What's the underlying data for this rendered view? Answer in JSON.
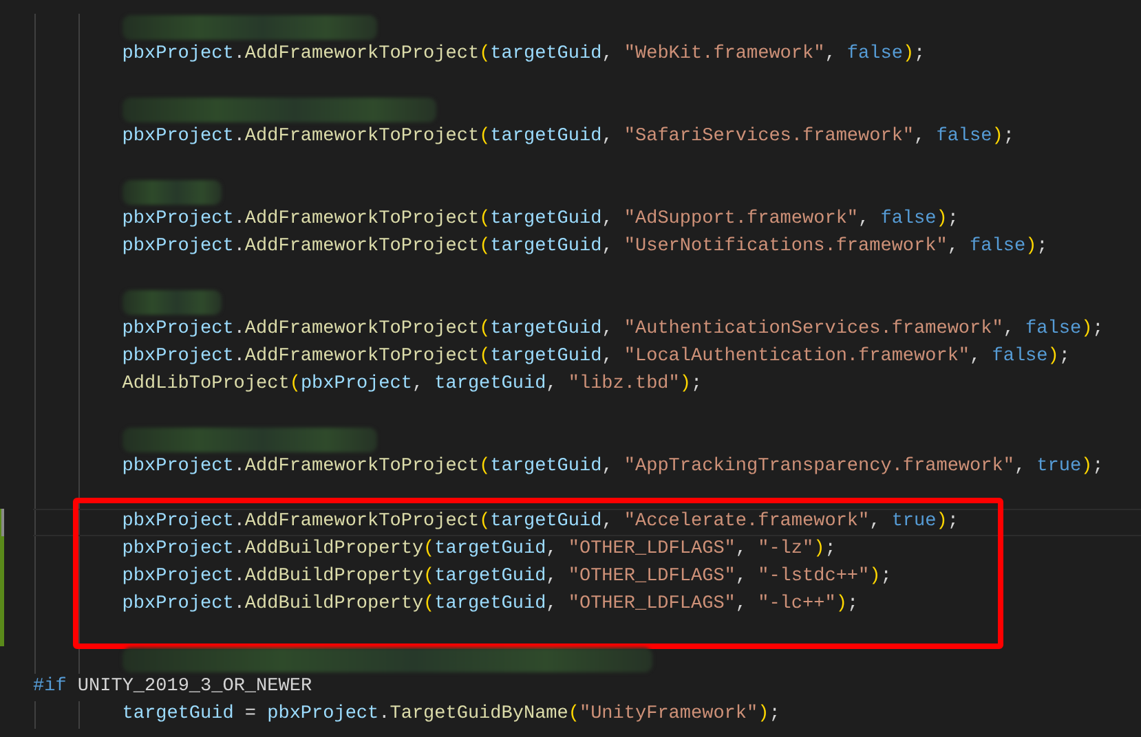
{
  "editor": {
    "lines": [
      {
        "kind": "blurred_medium"
      },
      {
        "kind": "code",
        "tokens": [
          {
            "kind": "var",
            "text": "pbxProject"
          },
          {
            "kind": "plain",
            "text": "."
          },
          {
            "kind": "method",
            "text": "AddFrameworkToProject"
          },
          {
            "kind": "paren",
            "text": "("
          },
          {
            "kind": "var",
            "text": "targetGuid"
          },
          {
            "kind": "plain",
            "text": ", "
          },
          {
            "kind": "string",
            "text": "\"WebKit.framework\""
          },
          {
            "kind": "plain",
            "text": ", "
          },
          {
            "kind": "keyword",
            "text": "false"
          },
          {
            "kind": "paren",
            "text": ")"
          },
          {
            "kind": "plain",
            "text": ";"
          }
        ]
      },
      {
        "kind": "blank"
      },
      {
        "kind": "blurred_long"
      },
      {
        "kind": "code",
        "tokens": [
          {
            "kind": "var",
            "text": "pbxProject"
          },
          {
            "kind": "plain",
            "text": "."
          },
          {
            "kind": "method",
            "text": "AddFrameworkToProject"
          },
          {
            "kind": "paren",
            "text": "("
          },
          {
            "kind": "var",
            "text": "targetGuid"
          },
          {
            "kind": "plain",
            "text": ", "
          },
          {
            "kind": "string",
            "text": "\"SafariServices.framework\""
          },
          {
            "kind": "plain",
            "text": ", "
          },
          {
            "kind": "keyword",
            "text": "false"
          },
          {
            "kind": "paren",
            "text": ")"
          },
          {
            "kind": "plain",
            "text": ";"
          }
        ]
      },
      {
        "kind": "blank"
      },
      {
        "kind": "blurred_short"
      },
      {
        "kind": "code",
        "tokens": [
          {
            "kind": "var",
            "text": "pbxProject"
          },
          {
            "kind": "plain",
            "text": "."
          },
          {
            "kind": "method",
            "text": "AddFrameworkToProject"
          },
          {
            "kind": "paren",
            "text": "("
          },
          {
            "kind": "var",
            "text": "targetGuid"
          },
          {
            "kind": "plain",
            "text": ", "
          },
          {
            "kind": "string",
            "text": "\"AdSupport.framework\""
          },
          {
            "kind": "plain",
            "text": ", "
          },
          {
            "kind": "keyword",
            "text": "false"
          },
          {
            "kind": "paren",
            "text": ")"
          },
          {
            "kind": "plain",
            "text": ";"
          }
        ]
      },
      {
        "kind": "code",
        "tokens": [
          {
            "kind": "var",
            "text": "pbxProject"
          },
          {
            "kind": "plain",
            "text": "."
          },
          {
            "kind": "method",
            "text": "AddFrameworkToProject"
          },
          {
            "kind": "paren",
            "text": "("
          },
          {
            "kind": "var",
            "text": "targetGuid"
          },
          {
            "kind": "plain",
            "text": ", "
          },
          {
            "kind": "string",
            "text": "\"UserNotifications.framework\""
          },
          {
            "kind": "plain",
            "text": ", "
          },
          {
            "kind": "keyword",
            "text": "false"
          },
          {
            "kind": "paren",
            "text": ")"
          },
          {
            "kind": "plain",
            "text": ";"
          }
        ]
      },
      {
        "kind": "blank"
      },
      {
        "kind": "blurred_short"
      },
      {
        "kind": "code",
        "tokens": [
          {
            "kind": "var",
            "text": "pbxProject"
          },
          {
            "kind": "plain",
            "text": "."
          },
          {
            "kind": "method",
            "text": "AddFrameworkToProject"
          },
          {
            "kind": "paren",
            "text": "("
          },
          {
            "kind": "var",
            "text": "targetGuid"
          },
          {
            "kind": "plain",
            "text": ", "
          },
          {
            "kind": "string",
            "text": "\"AuthenticationServices.framework\""
          },
          {
            "kind": "plain",
            "text": ", "
          },
          {
            "kind": "keyword",
            "text": "false"
          },
          {
            "kind": "paren",
            "text": ")"
          },
          {
            "kind": "plain",
            "text": ";"
          }
        ]
      },
      {
        "kind": "code",
        "tokens": [
          {
            "kind": "var",
            "text": "pbxProject"
          },
          {
            "kind": "plain",
            "text": "."
          },
          {
            "kind": "method",
            "text": "AddFrameworkToProject"
          },
          {
            "kind": "paren",
            "text": "("
          },
          {
            "kind": "var",
            "text": "targetGuid"
          },
          {
            "kind": "plain",
            "text": ", "
          },
          {
            "kind": "string",
            "text": "\"LocalAuthentication.framework\""
          },
          {
            "kind": "plain",
            "text": ", "
          },
          {
            "kind": "keyword",
            "text": "false"
          },
          {
            "kind": "paren",
            "text": ")"
          },
          {
            "kind": "plain",
            "text": ";"
          }
        ]
      },
      {
        "kind": "code",
        "tokens": [
          {
            "kind": "method",
            "text": "AddLibToProject"
          },
          {
            "kind": "paren",
            "text": "("
          },
          {
            "kind": "var",
            "text": "pbxProject"
          },
          {
            "kind": "plain",
            "text": ", "
          },
          {
            "kind": "var",
            "text": "targetGuid"
          },
          {
            "kind": "plain",
            "text": ", "
          },
          {
            "kind": "string",
            "text": "\"libz.tbd\""
          },
          {
            "kind": "paren",
            "text": ")"
          },
          {
            "kind": "plain",
            "text": ";"
          }
        ]
      },
      {
        "kind": "blank"
      },
      {
        "kind": "blurred_medium"
      },
      {
        "kind": "code",
        "tokens": [
          {
            "kind": "var",
            "text": "pbxProject"
          },
          {
            "kind": "plain",
            "text": "."
          },
          {
            "kind": "method",
            "text": "AddFrameworkToProject"
          },
          {
            "kind": "paren",
            "text": "("
          },
          {
            "kind": "var",
            "text": "targetGuid"
          },
          {
            "kind": "plain",
            "text": ", "
          },
          {
            "kind": "string",
            "text": "\"AppTrackingTransparency.framework\""
          },
          {
            "kind": "plain",
            "text": ", "
          },
          {
            "kind": "keyword",
            "text": "true"
          },
          {
            "kind": "paren",
            "text": ")"
          },
          {
            "kind": "plain",
            "text": ";"
          }
        ]
      },
      {
        "kind": "blank"
      },
      {
        "kind": "code",
        "current": true,
        "modified": true,
        "highlighted": true,
        "tokens": [
          {
            "kind": "var",
            "text": "pbxProject"
          },
          {
            "kind": "plain",
            "text": "."
          },
          {
            "kind": "method",
            "text": "AddFrameworkToProject"
          },
          {
            "kind": "paren",
            "text": "("
          },
          {
            "kind": "var",
            "text": "targetGuid"
          },
          {
            "kind": "plain",
            "text": ", "
          },
          {
            "kind": "string",
            "text": "\"Accelerate.framework\""
          },
          {
            "kind": "plain",
            "text": ", "
          },
          {
            "kind": "keyword",
            "text": "true"
          },
          {
            "kind": "paren",
            "text": ")"
          },
          {
            "kind": "plain",
            "text": ";"
          }
        ]
      },
      {
        "kind": "code",
        "modified": true,
        "highlighted": true,
        "tokens": [
          {
            "kind": "var",
            "text": "pbxProject"
          },
          {
            "kind": "plain",
            "text": "."
          },
          {
            "kind": "method",
            "text": "AddBuildProperty"
          },
          {
            "kind": "paren",
            "text": "("
          },
          {
            "kind": "var",
            "text": "targetGuid"
          },
          {
            "kind": "plain",
            "text": ", "
          },
          {
            "kind": "string",
            "text": "\"OTHER_LDFLAGS\""
          },
          {
            "kind": "plain",
            "text": ", "
          },
          {
            "kind": "string",
            "text": "\"-lz\""
          },
          {
            "kind": "paren",
            "text": ")"
          },
          {
            "kind": "plain",
            "text": ";"
          }
        ]
      },
      {
        "kind": "code",
        "modified": true,
        "highlighted": true,
        "tokens": [
          {
            "kind": "var",
            "text": "pbxProject"
          },
          {
            "kind": "plain",
            "text": "."
          },
          {
            "kind": "method",
            "text": "AddBuildProperty"
          },
          {
            "kind": "paren",
            "text": "("
          },
          {
            "kind": "var",
            "text": "targetGuid"
          },
          {
            "kind": "plain",
            "text": ", "
          },
          {
            "kind": "string",
            "text": "\"OTHER_LDFLAGS\""
          },
          {
            "kind": "plain",
            "text": ", "
          },
          {
            "kind": "string",
            "text": "\"-lstdc++\""
          },
          {
            "kind": "paren",
            "text": ")"
          },
          {
            "kind": "plain",
            "text": ";"
          }
        ]
      },
      {
        "kind": "code",
        "modified": true,
        "highlighted": true,
        "tokens": [
          {
            "kind": "var",
            "text": "pbxProject"
          },
          {
            "kind": "plain",
            "text": "."
          },
          {
            "kind": "method",
            "text": "AddBuildProperty"
          },
          {
            "kind": "paren",
            "text": "("
          },
          {
            "kind": "var",
            "text": "targetGuid"
          },
          {
            "kind": "plain",
            "text": ", "
          },
          {
            "kind": "string",
            "text": "\"OTHER_LDFLAGS\""
          },
          {
            "kind": "plain",
            "text": ", "
          },
          {
            "kind": "string",
            "text": "\"-lc++\""
          },
          {
            "kind": "paren",
            "text": ")"
          },
          {
            "kind": "plain",
            "text": ";"
          }
        ]
      },
      {
        "kind": "blank",
        "modified": true,
        "highlighted": true
      },
      {
        "kind": "blurred_xlong"
      },
      {
        "kind": "directive",
        "tokens": [
          {
            "kind": "keyword",
            "text": "#if"
          },
          {
            "kind": "plain",
            "text": " UNITY_2019_3_OR_NEWER"
          }
        ]
      },
      {
        "kind": "code",
        "tokens": [
          {
            "kind": "var",
            "text": "targetGuid"
          },
          {
            "kind": "plain",
            "text": " = "
          },
          {
            "kind": "var",
            "text": "pbxProject"
          },
          {
            "kind": "plain",
            "text": "."
          },
          {
            "kind": "method",
            "text": "TargetGuidByName"
          },
          {
            "kind": "paren",
            "text": "("
          },
          {
            "kind": "string",
            "text": "\"UnityFramework\""
          },
          {
            "kind": "paren",
            "text": ")"
          },
          {
            "kind": "plain",
            "text": ";"
          }
        ]
      }
    ]
  }
}
